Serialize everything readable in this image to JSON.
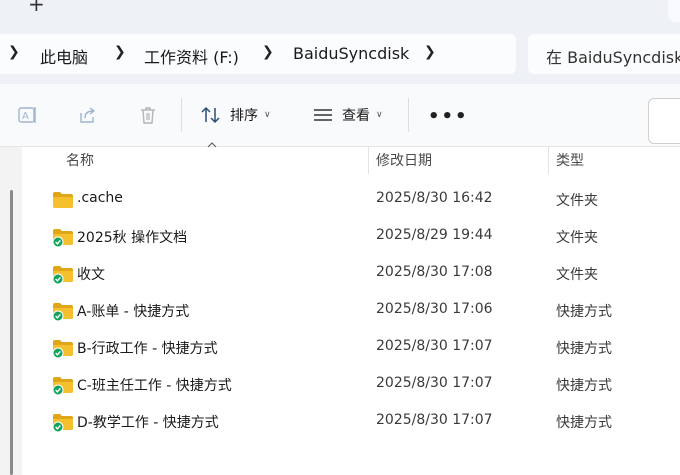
{
  "tabbar": {
    "new_tab": "+"
  },
  "address": {
    "crumbs": [
      "此电脑",
      "工作资料 (F:)",
      "BaiduSyncdisk"
    ],
    "search_text": "在 BaiduSyncdisk"
  },
  "toolbar": {
    "sort_label": "排序",
    "view_label": "查看",
    "more_label": "•••"
  },
  "columns": {
    "name": "名称",
    "date": "修改日期",
    "type": "类型"
  },
  "files": [
    {
      "name": ".cache",
      "date": "2025/8/30 16:42",
      "type": "文件夹",
      "synced": false
    },
    {
      "name": "2025秋 操作文档",
      "date": "2025/8/29 19:44",
      "type": "文件夹",
      "synced": true
    },
    {
      "name": "收文",
      "date": "2025/8/30 17:08",
      "type": "文件夹",
      "synced": true
    },
    {
      "name": "A-账单 - 快捷方式",
      "date": "2025/8/30 17:06",
      "type": "快捷方式",
      "synced": true
    },
    {
      "name": "B-行政工作 - 快捷方式",
      "date": "2025/8/30 17:07",
      "type": "快捷方式",
      "synced": true
    },
    {
      "name": "C-班主任工作 - 快捷方式",
      "date": "2025/8/30 17:07",
      "type": "快捷方式",
      "synced": true
    },
    {
      "name": "D-教学工作 - 快捷方式",
      "date": "2025/8/30 17:07",
      "type": "快捷方式",
      "synced": true
    }
  ],
  "colors": {
    "folder": "#f5c02e",
    "folder_dark": "#e0a618",
    "sync_badge": "#13a35a",
    "accent": "#0067c0"
  }
}
